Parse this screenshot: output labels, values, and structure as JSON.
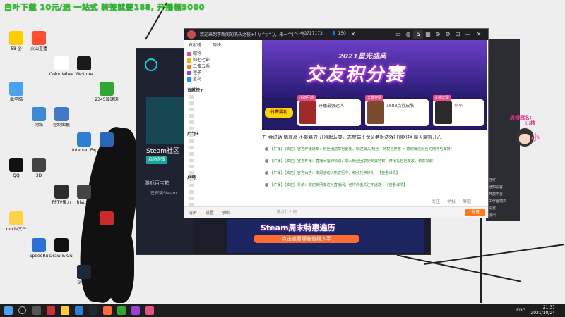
{
  "banner": "白叶下载 10元/送 一站式 转签就要188, 开播领5000",
  "desktop_icons": [
    {
      "label": "58 @",
      "color": "#ffcc00"
    },
    {
      "label": "火山直播",
      "color": "#ff4d2e"
    },
    {
      "label": "Color Wheel V1.0",
      "color": "#ffffff"
    },
    {
      "label": "WeStore",
      "color": "#1a1a1a"
    },
    {
      "label": "2345加速浏",
      "color": "#2fa82f"
    },
    {
      "label": "此电脑",
      "color": "#4aa3f0"
    },
    {
      "label": "网络",
      "color": "#3c8ad8"
    },
    {
      "label": "控制面板",
      "color": "#3f79c8"
    },
    {
      "label": "Internet Explorer",
      "color": "#2d7fd6"
    },
    {
      "label": "Realtek",
      "color": "#2766b8"
    },
    {
      "label": "QQ",
      "color": "#111111"
    },
    {
      "label": "3D",
      "color": "#444444"
    },
    {
      "label": "PPTV聚力",
      "color": "#2e2e2e"
    },
    {
      "label": "history",
      "color": "#444444"
    },
    {
      "label": "DEVOUR",
      "color": "#cc2a2a"
    },
    {
      "label": "mode文件",
      "color": "#ffd24a"
    },
    {
      "label": "SpeedRu",
      "color": "#2c6fd6"
    },
    {
      "label": "Draw & Guess",
      "color": "#111111"
    },
    {
      "label": "Steam",
      "color": "#1b2838"
    },
    {
      "label": "腾讯QQ",
      "color": "#111111"
    }
  ],
  "steam_window": {
    "title": "Steam社区",
    "start_button": "启动游戏",
    "section": "游戏百宝箱",
    "sub": "已安装Steam",
    "promo_title": "Steam周末特惠遍历",
    "promo_button": "点击查看哪些值得入手"
  },
  "right_window_items": [
    "挂件",
    "通知设置",
    "开放平台",
    "工作室模式",
    "设置",
    "退出"
  ],
  "anime": {
    "line1": "周榜冠名:",
    "line2": "山楂",
    "big": "小"
  },
  "douyu": {
    "title": "欢迎来到李新阁的洗头之夜+！\\(^▽^)/，来一个(^_^)~",
    "fans": "40717173",
    "viewers": "150",
    "rank_tabs": [
      "贡献榜",
      "周榜"
    ],
    "ranks": [
      {
        "name": "昵称",
        "color": "#e94f87"
      },
      {
        "name": "帅七七彩",
        "color": "#f2b400"
      },
      {
        "name": "三傻五乖",
        "color": "#ff7a1a"
      },
      {
        "name": "橙子",
        "color": "#9c3fd6"
      },
      {
        "name": "蓝鸟",
        "color": "#1a8cff"
      }
    ],
    "rank_labels": [
      "贡献榜+",
      "周榜+",
      "总榜"
    ],
    "banner_sub": "2021星光盛典",
    "banner_title": "交友积分赛",
    "lottery": "付费福利",
    "slots": [
      {
        "tag": "小助互动",
        "label": "开播最强达人"
      },
      {
        "tag": "天赏奖励",
        "label": "1688点券皮肤"
      },
      {
        "tag": "小游之星",
        "label": "小小"
      }
    ],
    "notice": "刀 会说话 情商高 不能暴力 开得起玩笑。态度端正保证老板游戏打得舒坦 聊天聊得开心",
    "messages": [
      "【广播】【欢迎】官方开播通知：粉丝团勋章已更新，欢迎加入/粉丝 | 特权已开放 > 感谢每位粉丝的陪伴与支持！",
      "【广播】【欢迎】官方开播：直播间福利领取，加入粉丝团享受专属特权，开播礼包已发放，快来领取！",
      "【广播】【欢迎】官方公告：本周活动火热进行中，积分兑换好礼 | 【查看详情】",
      "【广播】【欢迎】系统：欢迎新朋友进入直播间，记得点击关注不迷路 | 【查看详情】"
    ],
    "chat_tools": [
      "关注",
      "举报",
      "屏蔽"
    ],
    "input_placeholder": "说点什么吧...",
    "input_labels": [
      "清屏",
      "设置",
      "弹幕"
    ],
    "send": "发送"
  },
  "taskbar": {
    "time": "21:37",
    "date": "2021/10/24",
    "tray": "ENG"
  }
}
